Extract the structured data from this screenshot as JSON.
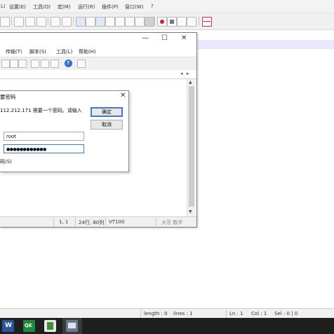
{
  "outer_app": {
    "menu": [
      "L)",
      "设置(E)",
      "工具(O)",
      "宏(M)",
      "运行(R)",
      "插件(P)",
      "窗口(W)",
      "?"
    ],
    "statusbar": {
      "length": "length : 0",
      "lines": "lines : 1",
      "ln": "Ln : 1",
      "col": "Col : 1",
      "sel": "Sel : 0 | 0"
    }
  },
  "terminal": {
    "menu": [
      "传输(T)",
      "脚本(S)",
      "工具(L)",
      "帮助(H)"
    ],
    "window_controls": [
      "—",
      "☐",
      "✕"
    ],
    "status": {
      "pos": "1,   1",
      "size": "24行, 80列",
      "term": "VT100",
      "caps": "大写  数字"
    }
  },
  "dialog": {
    "title": "要密码",
    "message": "112.212.171 需要一个密码。请输入",
    "ok_label": "确定",
    "cancel_label": "取消",
    "username": "root",
    "password": "●●●●●●●●●●●●",
    "save_label": "码(S)"
  },
  "taskbar": {
    "icons": [
      "word-icon",
      "excel-icon",
      "file-icon",
      "terminal-icon"
    ]
  }
}
